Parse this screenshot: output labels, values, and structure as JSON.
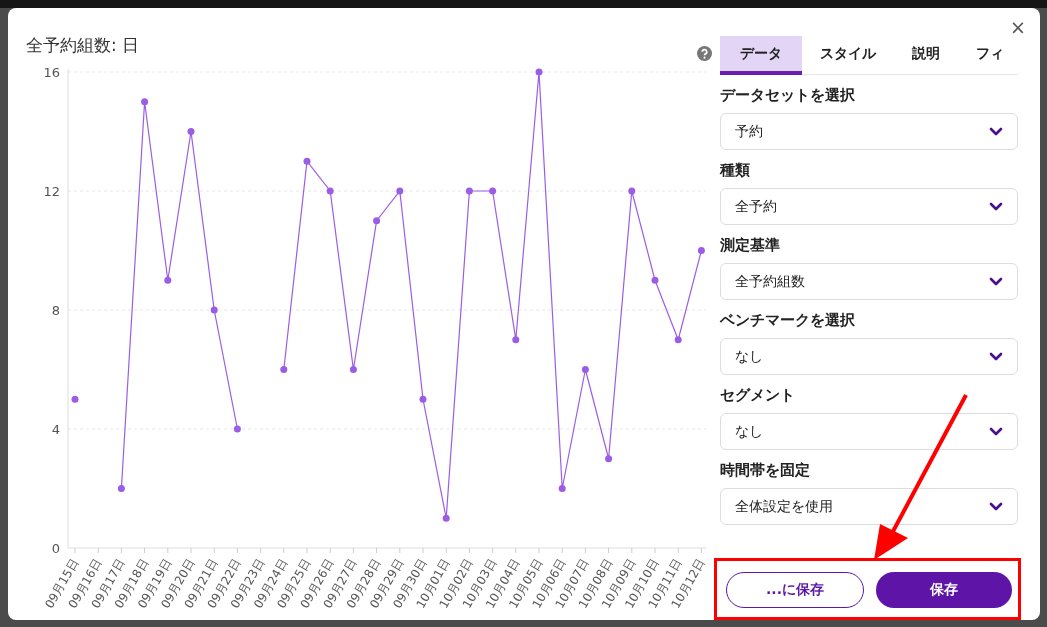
{
  "dialog": {
    "close": "×"
  },
  "chart": {
    "title": "全予約組数: 日",
    "chart_data": {
      "type": "line",
      "categories": [
        "09月15日",
        "09月16日",
        "09月17日",
        "09月18日",
        "09月19日",
        "09月20日",
        "09月21日",
        "09月22日",
        "09月23日",
        "09月24日",
        "09月25日",
        "09月26日",
        "09月27日",
        "09月28日",
        "09月29日",
        "09月30日",
        "10月01日",
        "10月02日",
        "10月03日",
        "10月04日",
        "10月05日",
        "10月06日",
        "10月07日",
        "10月08日",
        "10月09日",
        "10月10日",
        "10月11日",
        "10月12日"
      ],
      "series": [
        {
          "color": "#9b5de5",
          "values": [
            5,
            null,
            2,
            15,
            9,
            14,
            8,
            4,
            null,
            6,
            13,
            12,
            6,
            11,
            12,
            5,
            1,
            12,
            12,
            7,
            16,
            2,
            6,
            3,
            12,
            9,
            7,
            10
          ]
        }
      ],
      "ylim": [
        0,
        16
      ],
      "yticks": [
        0,
        4,
        8,
        12,
        16
      ],
      "grid": true,
      "marker": true
    }
  },
  "tabs": [
    {
      "label": "データ",
      "selected": true
    },
    {
      "label": "スタイル",
      "selected": false
    },
    {
      "label": "説明",
      "selected": false
    },
    {
      "label": "フィ",
      "selected": false
    }
  ],
  "fields": [
    {
      "label": "データセットを選択",
      "value": "予約"
    },
    {
      "label": "種類",
      "value": "全予約"
    },
    {
      "label": "測定基準",
      "value": "全予約組数"
    },
    {
      "label": "ベンチマークを選択",
      "value": "なし"
    },
    {
      "label": "セグメント",
      "value": "なし"
    },
    {
      "label": "時間帯を固定",
      "value": "全体設定を使用"
    }
  ],
  "buttons": [
    {
      "label": "...に保存",
      "kind": "outline"
    },
    {
      "label": "保存",
      "kind": "primary"
    }
  ]
}
